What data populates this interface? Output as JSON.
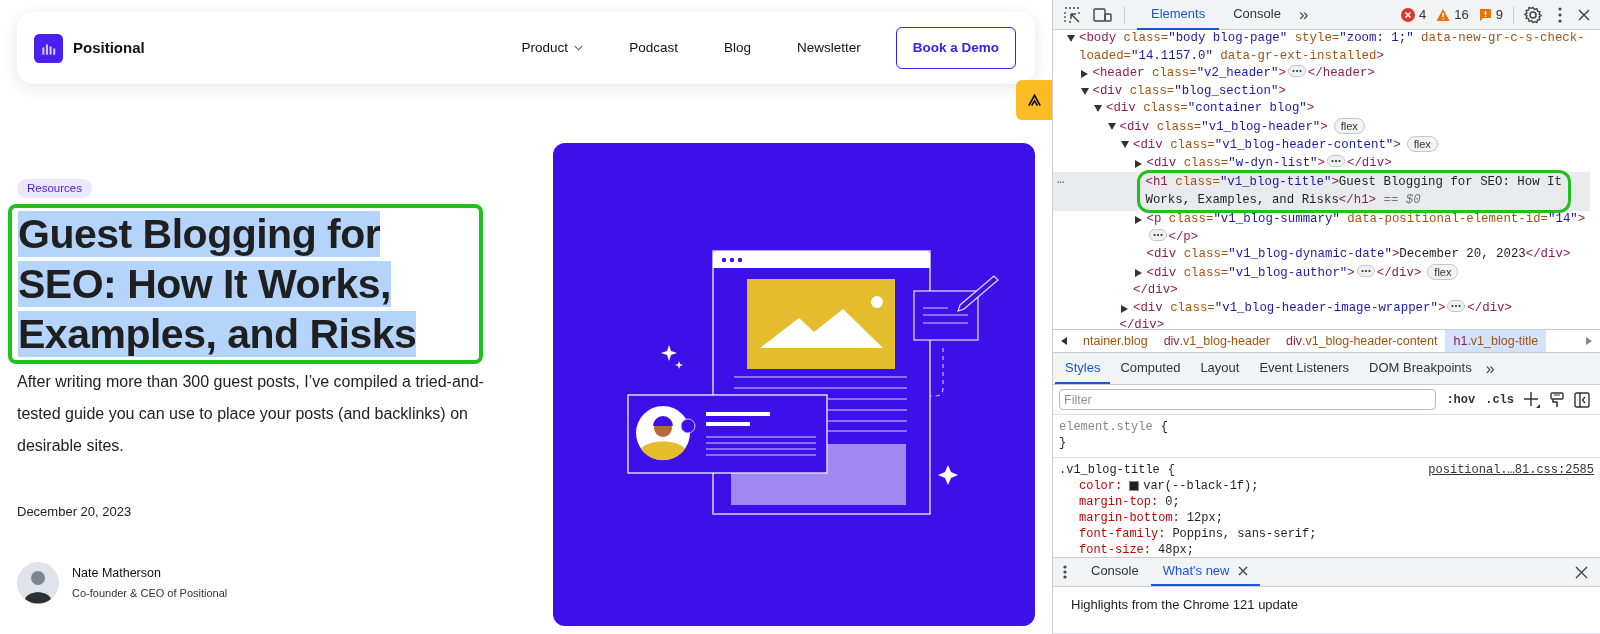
{
  "page": {
    "nav": {
      "logo": "Positional",
      "items": [
        {
          "label": "Product",
          "dropdown": true
        },
        {
          "label": "Podcast",
          "dropdown": false
        },
        {
          "label": "Blog",
          "dropdown": false
        },
        {
          "label": "Newsletter",
          "dropdown": false
        }
      ],
      "cta": "Book a Demo"
    },
    "tag": "Resources",
    "title": {
      "text": "Guest Blogging for SEO: How It Works, Examples, and Risks",
      "text_selected": true,
      "highlighted": true
    },
    "summary": "After writing more than 300 guest posts, I’ve compiled a tried-and-tested guide you can use to place your posts (and backlinks) on desirable sites.",
    "date": "December 20, 2023",
    "author": {
      "name": "Nate Matherson",
      "role": "Co-founder & CEO of Positional"
    }
  },
  "devtools": {
    "tabs": [
      {
        "label": "Elements",
        "selected": true
      },
      {
        "label": "Console",
        "selected": false
      }
    ],
    "more": "»",
    "issues": [
      {
        "kind": "error",
        "count": "4"
      },
      {
        "kind": "warning",
        "count": "16"
      },
      {
        "kind": "info",
        "count": "9"
      }
    ],
    "tree": [
      {
        "expanded": true,
        "selected": false,
        "lines": [
          [
            {
              "kind": "tag",
              "text": "<body"
            },
            {
              "kind": "attr",
              "text": " class="
            },
            {
              "kind": "value",
              "text": "\"body blog-page\""
            },
            {
              "kind": "attr",
              "text": " style="
            },
            {
              "kind": "value",
              "text": "\"zoom: 1;\""
            },
            {
              "kind": "attr",
              "text": " data-new-gr-c-s-check-"
            }
          ],
          [
            {
              "kind": "attr",
              "text": "loaded="
            },
            {
              "kind": "value",
              "text": "\"14.1157.0\""
            },
            {
              "kind": "attr",
              "text": " data-gr-ext-installed"
            },
            {
              "kind": "tag",
              "text": ">"
            }
          ]
        ],
        "children": [
          {
            "expanded": false,
            "selected": false,
            "lines": [
              [
                {
                  "kind": "tag",
                  "text": "<header"
                },
                {
                  "kind": "attr",
                  "text": " class="
                },
                {
                  "kind": "value",
                  "text": "\"v2_header\""
                },
                {
                  "kind": "tag",
                  "text": ">"
                },
                {
                  "kind": "ellipsis"
                },
                {
                  "kind": "tag",
                  "text": "</header>"
                }
              ]
            ]
          },
          {
            "expanded": true,
            "selected": false,
            "lines": [
              [
                {
                  "kind": "tag",
                  "text": "<div"
                },
                {
                  "kind": "attr",
                  "text": " class="
                },
                {
                  "kind": "value",
                  "text": "\"blog_section\""
                },
                {
                  "kind": "tag",
                  "text": ">"
                }
              ]
            ],
            "children": [
              {
                "expanded": true,
                "selected": false,
                "lines": [
                  [
                    {
                      "kind": "tag",
                      "text": "<div"
                    },
                    {
                      "kind": "attr",
                      "text": " class="
                    },
                    {
                      "kind": "value",
                      "text": "\"container blog\""
                    },
                    {
                      "kind": "tag",
                      "text": ">"
                    }
                  ]
                ],
                "children": [
                  {
                    "expanded": true,
                    "selected": false,
                    "lines": [
                      [
                        {
                          "kind": "tag",
                          "text": "<div"
                        },
                        {
                          "kind": "attr",
                          "text": " class="
                        },
                        {
                          "kind": "value",
                          "text": "\"v1_blog-header\""
                        },
                        {
                          "kind": "tag",
                          "text": ">"
                        },
                        {
                          "kind": "badge",
                          "text": "flex"
                        }
                      ]
                    ],
                    "closing": "</div>",
                    "children": [
                      {
                        "expanded": true,
                        "selected": false,
                        "lines": [
                          [
                            {
                              "kind": "tag",
                              "text": "<div"
                            },
                            {
                              "kind": "attr",
                              "text": " class="
                            },
                            {
                              "kind": "value",
                              "text": "\"v1_blog-header-content\""
                            },
                            {
                              "kind": "tag",
                              "text": ">"
                            },
                            {
                              "kind": "badge",
                              "text": "flex"
                            }
                          ]
                        ],
                        "closing": "</div>",
                        "children": [
                          {
                            "expanded": false,
                            "selected": false,
                            "lines": [
                              [
                                {
                                  "kind": "tag",
                                  "text": "<div"
                                },
                                {
                                  "kind": "attr",
                                  "text": " class="
                                },
                                {
                                  "kind": "value",
                                  "text": "\"w-dyn-list\""
                                },
                                {
                                  "kind": "tag",
                                  "text": ">"
                                },
                                {
                                  "kind": "ellipsis"
                                },
                                {
                                  "kind": "tag",
                                  "text": "</div>"
                                }
                              ]
                            ]
                          },
                          {
                            "selected": true,
                            "highlighted": true,
                            "gutter": "…",
                            "lines": [
                              [
                                {
                                  "kind": "tag",
                                  "text": "<h1"
                                },
                                {
                                  "kind": "attr",
                                  "text": " class="
                                },
                                {
                                  "kind": "value",
                                  "text": "\"v1_blog-title\""
                                },
                                {
                                  "kind": "tag",
                                  "text": ">"
                                },
                                {
                                  "kind": "text",
                                  "text": "Guest Blogging for SEO: How It"
                                }
                              ],
                              [
                                {
                                  "kind": "text",
                                  "text": "Works, Examples, and Risks"
                                },
                                {
                                  "kind": "tag",
                                  "text": "</h1>"
                                },
                                {
                                  "kind": "marker",
                                  "text": " == $0"
                                }
                              ]
                            ]
                          },
                          {
                            "expanded": false,
                            "selected": false,
                            "lines": [
                              [
                                {
                                  "kind": "tag",
                                  "text": "<p"
                                },
                                {
                                  "kind": "attr",
                                  "text": " class="
                                },
                                {
                                  "kind": "value",
                                  "text": "\"v1_blog-summary\""
                                },
                                {
                                  "kind": "attr",
                                  "text": " data-positional-element-id="
                                },
                                {
                                  "kind": "value",
                                  "text": "\"14\""
                                },
                                {
                                  "kind": "tag",
                                  "text": ">"
                                }
                              ],
                              [
                                {
                                  "kind": "ellipsis"
                                },
                                {
                                  "kind": "tag",
                                  "text": "</p>"
                                }
                              ]
                            ]
                          },
                          {
                            "selected": false,
                            "lines": [
                              [
                                {
                                  "kind": "tag",
                                  "text": "<div"
                                },
                                {
                                  "kind": "attr",
                                  "text": " class="
                                },
                                {
                                  "kind": "value",
                                  "text": "\"v1_blog-dynamic-date\""
                                },
                                {
                                  "kind": "tag",
                                  "text": ">"
                                },
                                {
                                  "kind": "text",
                                  "text": "December 20, 2023"
                                },
                                {
                                  "kind": "tag",
                                  "text": "</div>"
                                }
                              ]
                            ]
                          },
                          {
                            "expanded": false,
                            "selected": false,
                            "lines": [
                              [
                                {
                                  "kind": "tag",
                                  "text": "<div"
                                },
                                {
                                  "kind": "attr",
                                  "text": " class="
                                },
                                {
                                  "kind": "value",
                                  "text": "\"v1_blog-author\""
                                },
                                {
                                  "kind": "tag",
                                  "text": ">"
                                },
                                {
                                  "kind": "ellipsis"
                                },
                                {
                                  "kind": "tag",
                                  "text": "</div>"
                                },
                                {
                                  "kind": "badge",
                                  "text": "flex"
                                }
                              ]
                            ]
                          }
                        ]
                      },
                      {
                        "expanded": false,
                        "selected": false,
                        "lines": [
                          [
                            {
                              "kind": "tag",
                              "text": "<div"
                            },
                            {
                              "kind": "attr",
                              "text": " class="
                            },
                            {
                              "kind": "value",
                              "text": "\"v1_blog-header-image-wrapper\""
                            },
                            {
                              "kind": "tag",
                              "text": ">"
                            },
                            {
                              "kind": "ellipsis"
                            },
                            {
                              "kind": "tag",
                              "text": "</div>"
                            }
                          ]
                        ]
                      }
                    ]
                  }
                ]
              }
            ]
          }
        ]
      }
    ],
    "breadcrumbs": [
      {
        "class": "ntainer.blog",
        "selected": false
      },
      {
        "tag": "div",
        "class": ".v1_blog-header",
        "selected": false
      },
      {
        "tag": "div",
        "class": ".v1_blog-header-content",
        "selected": false
      },
      {
        "tag": "h1",
        "class": ".v1_blog-title",
        "selected": true
      }
    ],
    "pane_tabs": [
      {
        "label": "Styles",
        "selected": true
      },
      {
        "label": "Computed",
        "selected": false
      },
      {
        "label": "Layout",
        "selected": false
      },
      {
        "label": "Event Listeners",
        "selected": false
      },
      {
        "label": "DOM Breakpoints",
        "selected": false
      }
    ],
    "pane_more": "»",
    "filter": {
      "placeholder": "Filter"
    },
    "hov": ":hov",
    "cls": ".cls",
    "rules": [
      {
        "selector": "element.style",
        "open": "{",
        "close": "}"
      },
      {
        "selector": ".v1_blog-title",
        "open": "{",
        "source": "positional.…81.css:2585",
        "declarations": [
          {
            "property": "color:",
            "value": "var(--black-1f);",
            "swatch": true
          },
          {
            "property": "margin-top:",
            "value": "0;"
          },
          {
            "property": "margin-bottom:",
            "value": "12px;"
          },
          {
            "property": "font-family:",
            "value": "Poppins, sans-serif;"
          },
          {
            "property": "font-size:",
            "value": "48px;"
          }
        ]
      }
    ],
    "drawer": {
      "tabs": [
        {
          "label": "Console",
          "selected": false,
          "closable": false
        },
        {
          "label": "What's new",
          "selected": true,
          "closable": true
        }
      ],
      "content": "Highlights from the Chrome 121 update"
    }
  }
}
